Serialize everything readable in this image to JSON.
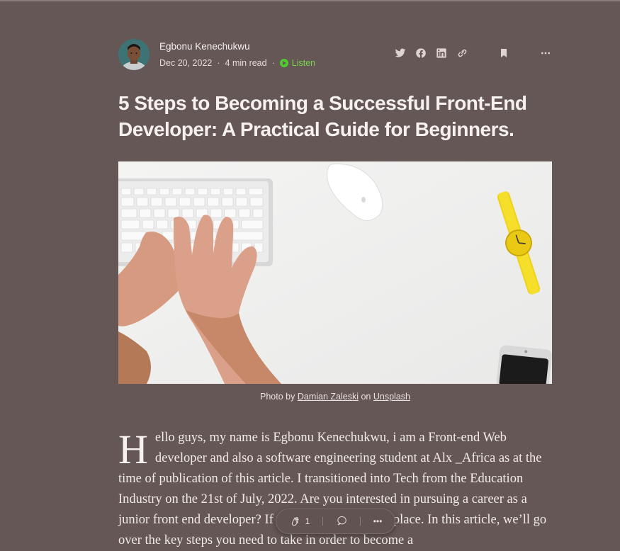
{
  "author": {
    "name": "Egbonu Kenechukwu",
    "date": "Dec 20, 2022",
    "read_time": "4 min read",
    "listen_label": "Listen"
  },
  "actions": {
    "icons": [
      "twitter-icon",
      "facebook-icon",
      "linkedin-icon",
      "link-icon",
      "bookmark-icon",
      "more-icon"
    ]
  },
  "article": {
    "title": "5 Steps to Becoming a Successful Front-End Developer: A Practical Guide for Beginners.",
    "caption_prefix": "Photo by",
    "caption_author": "Damian Zaleski",
    "caption_on": "on",
    "caption_source": "Unsplash",
    "drop_cap": "H",
    "body": "ello guys, my name is Egbonu Kenechukwu, i am a Front-end Web developer and also a software engineering student at Alx _Africa as at the time of publication of this article. I transitioned into Tech from the Education Industry on the 21st of July, 2022. Are you interested in pursuing a career as a junior front end developer? If so, you’re in the right place. In this article, we’ll go over the key steps you need to take in order to become a"
  },
  "floating_bar": {
    "clap_count": "1",
    "more_label": "•••"
  },
  "colors": {
    "background": "#655755",
    "listen_green": "#4fcb2f"
  }
}
